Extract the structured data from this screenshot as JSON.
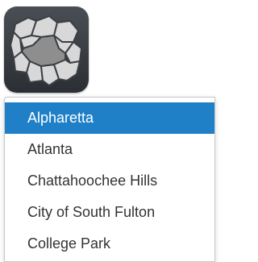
{
  "app": {
    "icon": "fulton-county-map-icon",
    "accent_color": "#1f80c8"
  },
  "dropdown": {
    "selected_index": 0,
    "options": [
      "Alpharetta",
      "Atlanta",
      "Chattahoochee Hills",
      "City of South Fulton",
      "College Park"
    ]
  }
}
